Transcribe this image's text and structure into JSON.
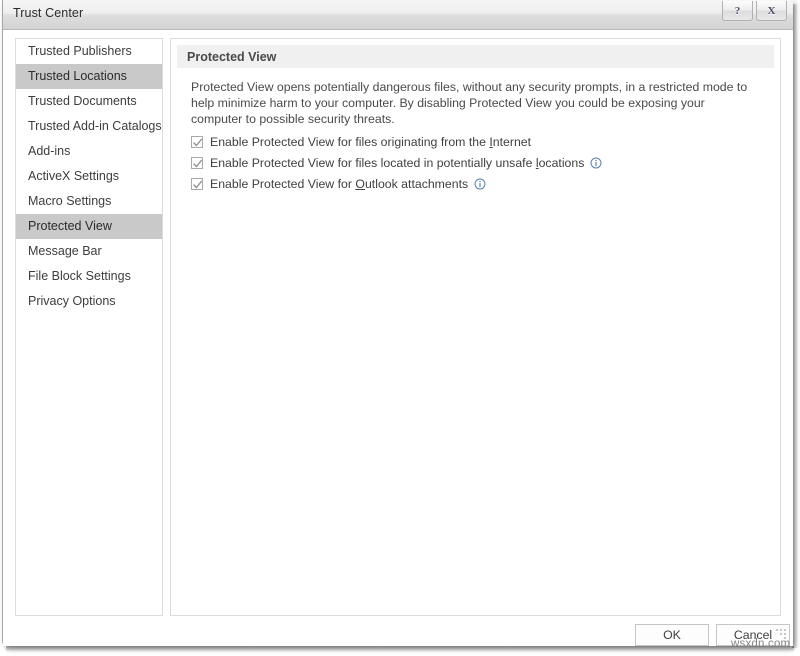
{
  "window": {
    "title": "Trust Center",
    "caption_buttons": [
      {
        "name": "help",
        "glyph": "?"
      },
      {
        "name": "close",
        "glyph": "X"
      }
    ]
  },
  "sidebar": {
    "items": [
      {
        "label": "Trusted Publishers",
        "selected": false
      },
      {
        "label": "Trusted Locations",
        "selected": true
      },
      {
        "label": "Trusted Documents",
        "selected": false
      },
      {
        "label": "Trusted Add-in Catalogs",
        "selected": false
      },
      {
        "label": "Add-ins",
        "selected": false
      },
      {
        "label": "ActiveX Settings",
        "selected": false
      },
      {
        "label": "Macro Settings",
        "selected": false
      },
      {
        "label": "Protected View",
        "selected": true
      },
      {
        "label": "Message Bar",
        "selected": false
      },
      {
        "label": "File Block Settings",
        "selected": false
      },
      {
        "label": "Privacy Options",
        "selected": false
      }
    ]
  },
  "main": {
    "section_title": "Protected View",
    "description": "Protected View opens potentially dangerous files, without any security prompts, in a restricted mode to help minimize harm to your computer. By disabling Protected View you could be exposing your computer to possible security threats.",
    "checkboxes": [
      {
        "label": "Enable Protected View for files originating from the Internet",
        "before": "Enable Protected View for files originating from the ",
        "accel": "I",
        "after": "nternet",
        "checked": true,
        "has_info": false
      },
      {
        "label": "Enable Protected View for files located in potentially unsafe locations",
        "before": "Enable Protected View for files located in potentially unsafe ",
        "accel": "l",
        "after": "ocations",
        "checked": true,
        "has_info": true
      },
      {
        "label": "Enable Protected View for Outlook attachments",
        "before": "Enable Protected View for ",
        "accel": "O",
        "after": "utlook attachments",
        "checked": true,
        "has_info": true
      }
    ]
  },
  "footer": {
    "ok_label": "OK",
    "cancel_label": "Cancel"
  },
  "watermark": "wsxdn.com",
  "colors": {
    "selected_row": "#c9c9c9",
    "section_header_bg": "#f0f0f0",
    "panel_border": "#dcdcdc",
    "text": "#3f3f3f",
    "info_icon": "#5b7fa6"
  }
}
